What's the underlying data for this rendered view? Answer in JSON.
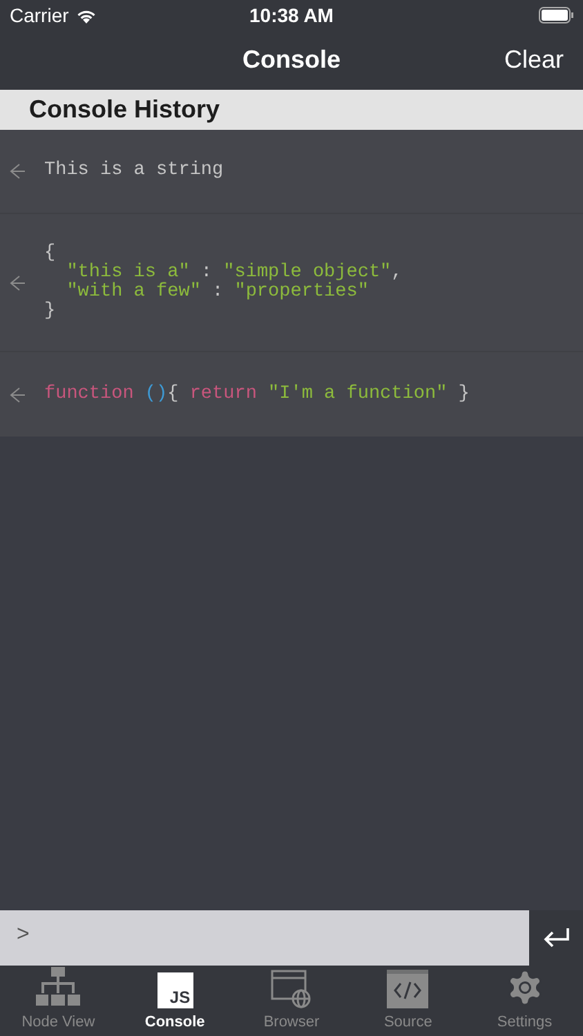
{
  "status_bar": {
    "carrier": "Carrier",
    "time": "10:38 AM"
  },
  "nav": {
    "title": "Console",
    "action": "Clear"
  },
  "section_header": "Console History",
  "entries": [
    {
      "lines": [
        [
          {
            "text": "This is a string",
            "kind": "plain"
          }
        ]
      ]
    },
    {
      "lines": [
        [
          {
            "text": "{",
            "kind": "plain"
          }
        ],
        [
          {
            "text": "  \"this is a\"",
            "kind": "string"
          },
          {
            "text": " : ",
            "kind": "plain"
          },
          {
            "text": "\"simple object\"",
            "kind": "string"
          },
          {
            "text": ",",
            "kind": "plain"
          }
        ],
        [
          {
            "text": "  \"with a few\"",
            "kind": "string"
          },
          {
            "text": " : ",
            "kind": "plain"
          },
          {
            "text": "\"properties\"",
            "kind": "string"
          }
        ],
        [
          {
            "text": "}",
            "kind": "plain"
          }
        ]
      ]
    },
    {
      "lines": [
        [
          {
            "text": "function ",
            "kind": "keyword"
          },
          {
            "text": "()",
            "kind": "paren"
          },
          {
            "text": "{ ",
            "kind": "plain"
          },
          {
            "text": "return ",
            "kind": "keyword"
          },
          {
            "text": "\"I'm a function\"",
            "kind": "string"
          },
          {
            "text": " }",
            "kind": "plain"
          }
        ]
      ]
    }
  ],
  "input": {
    "prompt": ">"
  },
  "tabs": [
    {
      "label": "Node View",
      "kind": "tree",
      "selected": false
    },
    {
      "label": "Console",
      "kind": "js",
      "icon_text": "JS",
      "selected": true
    },
    {
      "label": "Browser",
      "kind": "browser",
      "selected": false
    },
    {
      "label": "Source",
      "kind": "source",
      "selected": false
    },
    {
      "label": "Settings",
      "kind": "gear",
      "selected": false
    }
  ]
}
